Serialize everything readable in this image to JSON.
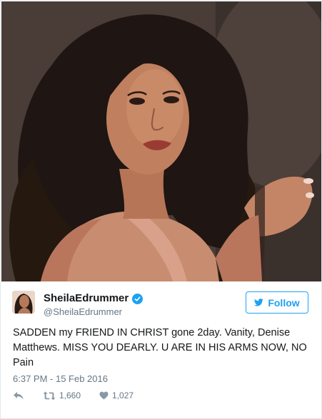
{
  "tweet": {
    "author": {
      "display_name": "SheilaEdrummer",
      "handle": "@SheilaEdrummer",
      "verified": true
    },
    "follow_label": "Follow",
    "text": "SADDEN my FRIEND IN CHRIST gone 2day. Vanity, Denise Matthews. MISS YOU DEARLY. U ARE IN HIS ARMS NOW, NO Pain",
    "timestamp": "6:37 PM - 15 Feb 2016",
    "retweet_count": "1,660",
    "like_count": "1,027"
  },
  "icons": {
    "verified": "verified-badge-icon",
    "follow": "twitter-bird-icon",
    "reply": "reply-arrow-icon",
    "retweet": "retweet-icon",
    "like": "heart-icon"
  },
  "colors": {
    "accent": "#1da1f2",
    "text": "#14171a",
    "secondary_text": "#657786",
    "border": "#e1e8ed"
  }
}
